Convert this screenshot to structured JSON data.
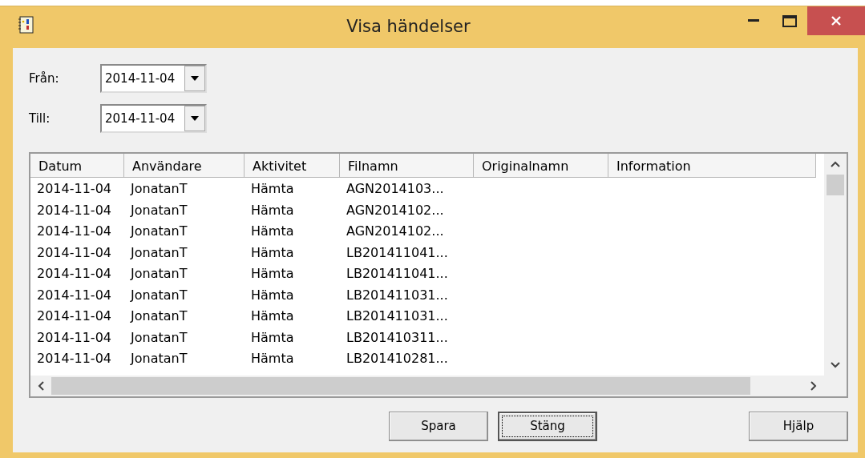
{
  "window": {
    "title": "Visa händelser"
  },
  "filters": [
    {
      "label": "Från:",
      "value": "2014-11-04"
    },
    {
      "label": "Till:",
      "value": "2014-11-04"
    }
  ],
  "table": {
    "columns": [
      "Datum",
      "Användare",
      "Aktivitet",
      "Filnamn",
      "Originalnamn",
      "Information"
    ],
    "rows": [
      [
        "2014-11-04",
        "JonatanT",
        "Hämta",
        "AGN2014103..."
      ],
      [
        "2014-11-04",
        "JonatanT",
        "Hämta",
        "AGN2014102..."
      ],
      [
        "2014-11-04",
        "JonatanT",
        "Hämta",
        "AGN2014102..."
      ],
      [
        "2014-11-04",
        "JonatanT",
        "Hämta",
        "LB201411041..."
      ],
      [
        "2014-11-04",
        "JonatanT",
        "Hämta",
        "LB201411041..."
      ],
      [
        "2014-11-04",
        "JonatanT",
        "Hämta",
        "LB201411031..."
      ],
      [
        "2014-11-04",
        "JonatanT",
        "Hämta",
        "LB201411031..."
      ],
      [
        "2014-11-04",
        "JonatanT",
        "Hämta",
        "LB201410311..."
      ],
      [
        "2014-11-04",
        "JonatanT",
        "Hämta",
        "LB201410281..."
      ]
    ]
  },
  "buttons": [
    {
      "label": "Spara",
      "focused": false
    },
    {
      "label": "Stäng",
      "focused": true
    },
    {
      "label": "Hjälp",
      "focused": false
    }
  ]
}
